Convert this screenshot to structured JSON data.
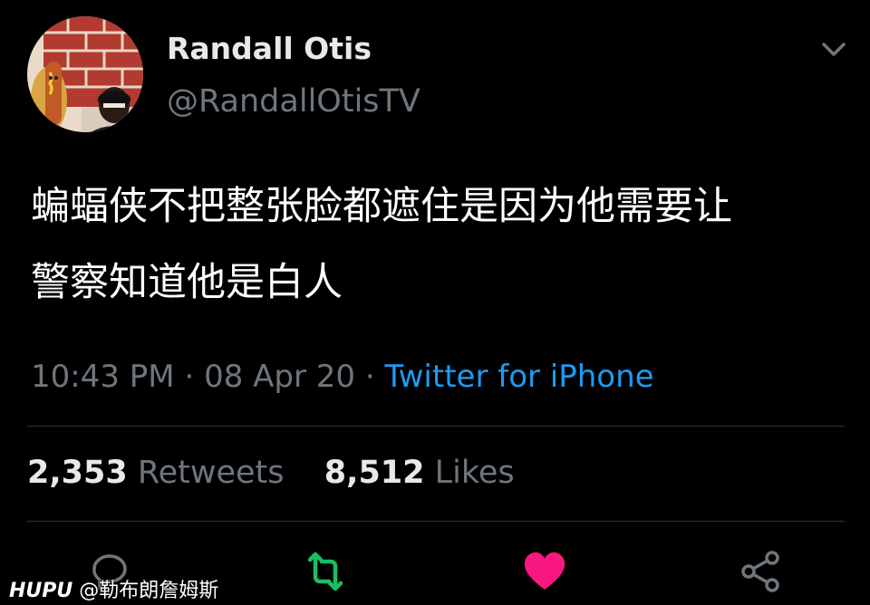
{
  "user": {
    "display_name": "Randall Otis",
    "handle": "@RandallOtisTV"
  },
  "tweet": {
    "text_line1": "蝙蝠侠不把整张脸都遮住是因为他需要让",
    "text_line2": "警察知道他是白人",
    "time": "10:43 PM",
    "date": "08 Apr 20",
    "source": "Twitter for iPhone"
  },
  "stats": {
    "retweets_count": "2,353",
    "retweets_label": "Retweets",
    "likes_count": "8,512",
    "likes_label": "Likes"
  },
  "actions": [
    "reply-icon",
    "retweet-icon",
    "like-icon",
    "share-icon"
  ],
  "colors": {
    "background": "#000000",
    "muted": "#6e767d",
    "link": "#1d9bf0",
    "retweet": "#17bf63",
    "like": "#f91880"
  },
  "watermark": {
    "brand": "HUPU",
    "user": "@勒布朗詹姆斯"
  }
}
